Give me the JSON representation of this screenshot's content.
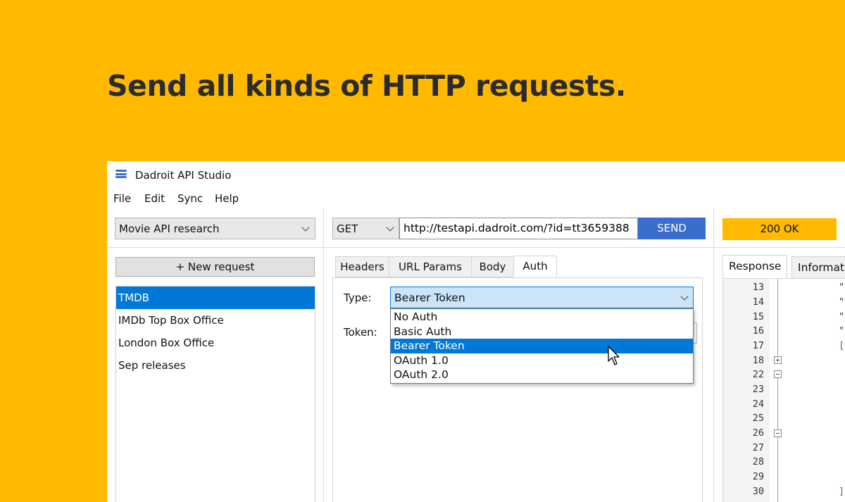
{
  "headline": "Send all kinds of HTTP requests.",
  "window": {
    "title": "Dadroit API Studio"
  },
  "menu": [
    "File",
    "Edit",
    "Sync",
    "Help"
  ],
  "project_select": {
    "value": "Movie API research"
  },
  "request_bar": {
    "method": "GET",
    "url": "http://testapi.dadroit.com/?id=tt3659388",
    "send_label": "SEND"
  },
  "status": {
    "text": "200 OK",
    "color": "#FFBA00"
  },
  "sidebar": {
    "new_request_label": "+ New request",
    "items": [
      {
        "label": "TMDB",
        "selected": true
      },
      {
        "label": "IMDb Top Box Office",
        "selected": false
      },
      {
        "label": "London Box Office",
        "selected": false
      },
      {
        "label": "Sep releases",
        "selected": false
      }
    ]
  },
  "request_tabs": [
    "Headers",
    "URL Params",
    "Body",
    "Auth"
  ],
  "active_request_tab": "Auth",
  "auth": {
    "type_label": "Type:",
    "type_value": "Bearer Token",
    "token_label": "Token:",
    "options": [
      "No Auth",
      "Basic Auth",
      "Bearer Token",
      "OAuth 1.0",
      "OAuth 2.0"
    ],
    "highlighted_option": "Bearer Token"
  },
  "response_tabs": [
    "Response",
    "Informati"
  ],
  "active_response_tab": "Response",
  "response": {
    "line_numbers": [
      "13",
      "14",
      "15",
      "16",
      "17",
      "18",
      "22",
      "23",
      "24",
      "25",
      "26",
      "27",
      "28",
      "29",
      "30"
    ],
    "fragments": [
      "\"",
      "\"",
      "\"",
      "\"",
      "[",
      "]"
    ]
  },
  "colors": {
    "background": "#FFBA00",
    "accent": "#3b6ccf",
    "selection": "#0078d7"
  }
}
